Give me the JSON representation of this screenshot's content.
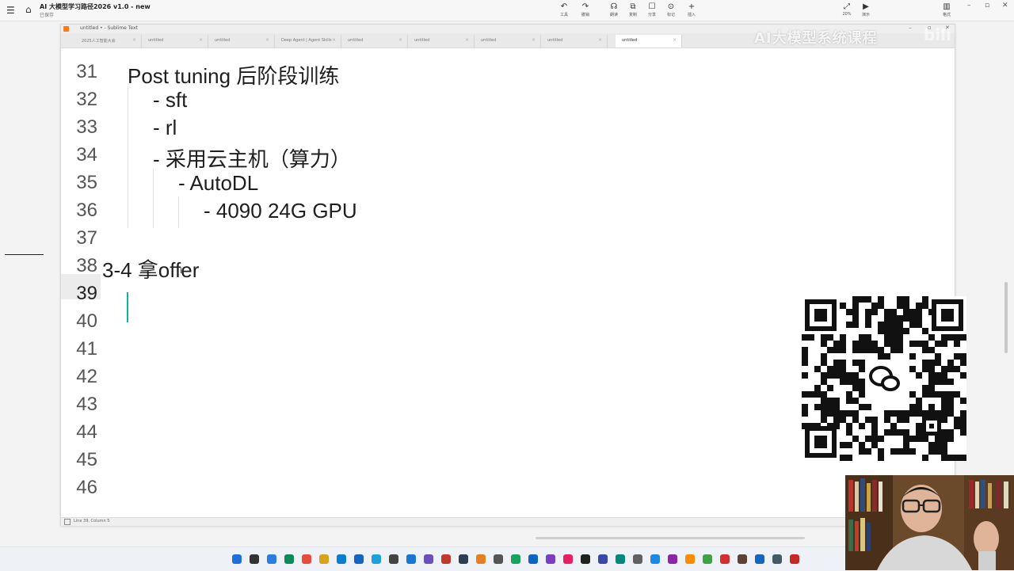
{
  "app": {
    "title": "AI 大模型学习路径2026 v1.0 - new",
    "subtitle": "已保存",
    "toolbar": [
      {
        "icon": "undo-icon",
        "glyph": "↶",
        "label": "工具"
      },
      {
        "icon": "redo-icon",
        "glyph": "↷",
        "label": "撤销"
      },
      {
        "icon": "headphone-icon",
        "glyph": "☊",
        "label": "朗读"
      },
      {
        "icon": "copy-icon",
        "glyph": "⧉",
        "label": "复制"
      },
      {
        "icon": "frame-icon",
        "glyph": "☐",
        "label": "分享"
      },
      {
        "icon": "mark-icon",
        "glyph": "⊙",
        "label": "标记"
      },
      {
        "icon": "insert-icon",
        "glyph": "+",
        "label": "插入"
      }
    ],
    "right_tools": [
      {
        "icon": "zoom-icon",
        "glyph": "⤢",
        "label": "20%"
      },
      {
        "icon": "play-icon",
        "glyph": "▶",
        "label": "演示"
      },
      {
        "icon": "layout-icon",
        "glyph": "▥",
        "label": "格式"
      }
    ]
  },
  "sublime": {
    "window_title": "untitled • - Sublime Text",
    "tabs": [
      {
        "label": "2025人工智能大会"
      },
      {
        "label": "untitled"
      },
      {
        "label": "untitled"
      },
      {
        "label": "Deep Agent | Agent Skills"
      },
      {
        "label": "untitled"
      },
      {
        "label": "untitled"
      },
      {
        "label": "untitled"
      },
      {
        "label": "untitled"
      },
      {
        "label": "untitled"
      }
    ],
    "line_numbers": [
      "31",
      "32",
      "33",
      "34",
      "35",
      "36",
      "37",
      "38",
      "39",
      "40",
      "41",
      "42",
      "43",
      "44",
      "45",
      "46"
    ],
    "lines": [
      {
        "text": "Post tuning 后阶段训练"
      },
      {
        "text": "- sft"
      },
      {
        "text": "- rl"
      },
      {
        "text": "- 采用云主机（算力）"
      },
      {
        "text": "- AutoDL"
      },
      {
        "text": "- 4090 24G GPU"
      },
      {
        "text": ""
      },
      {
        "text": "3-4 拿offer"
      }
    ],
    "status": "Line 39, Column 5"
  },
  "watermark": {
    "text": "AI大模型系统课程",
    "brand": "bili"
  }
}
